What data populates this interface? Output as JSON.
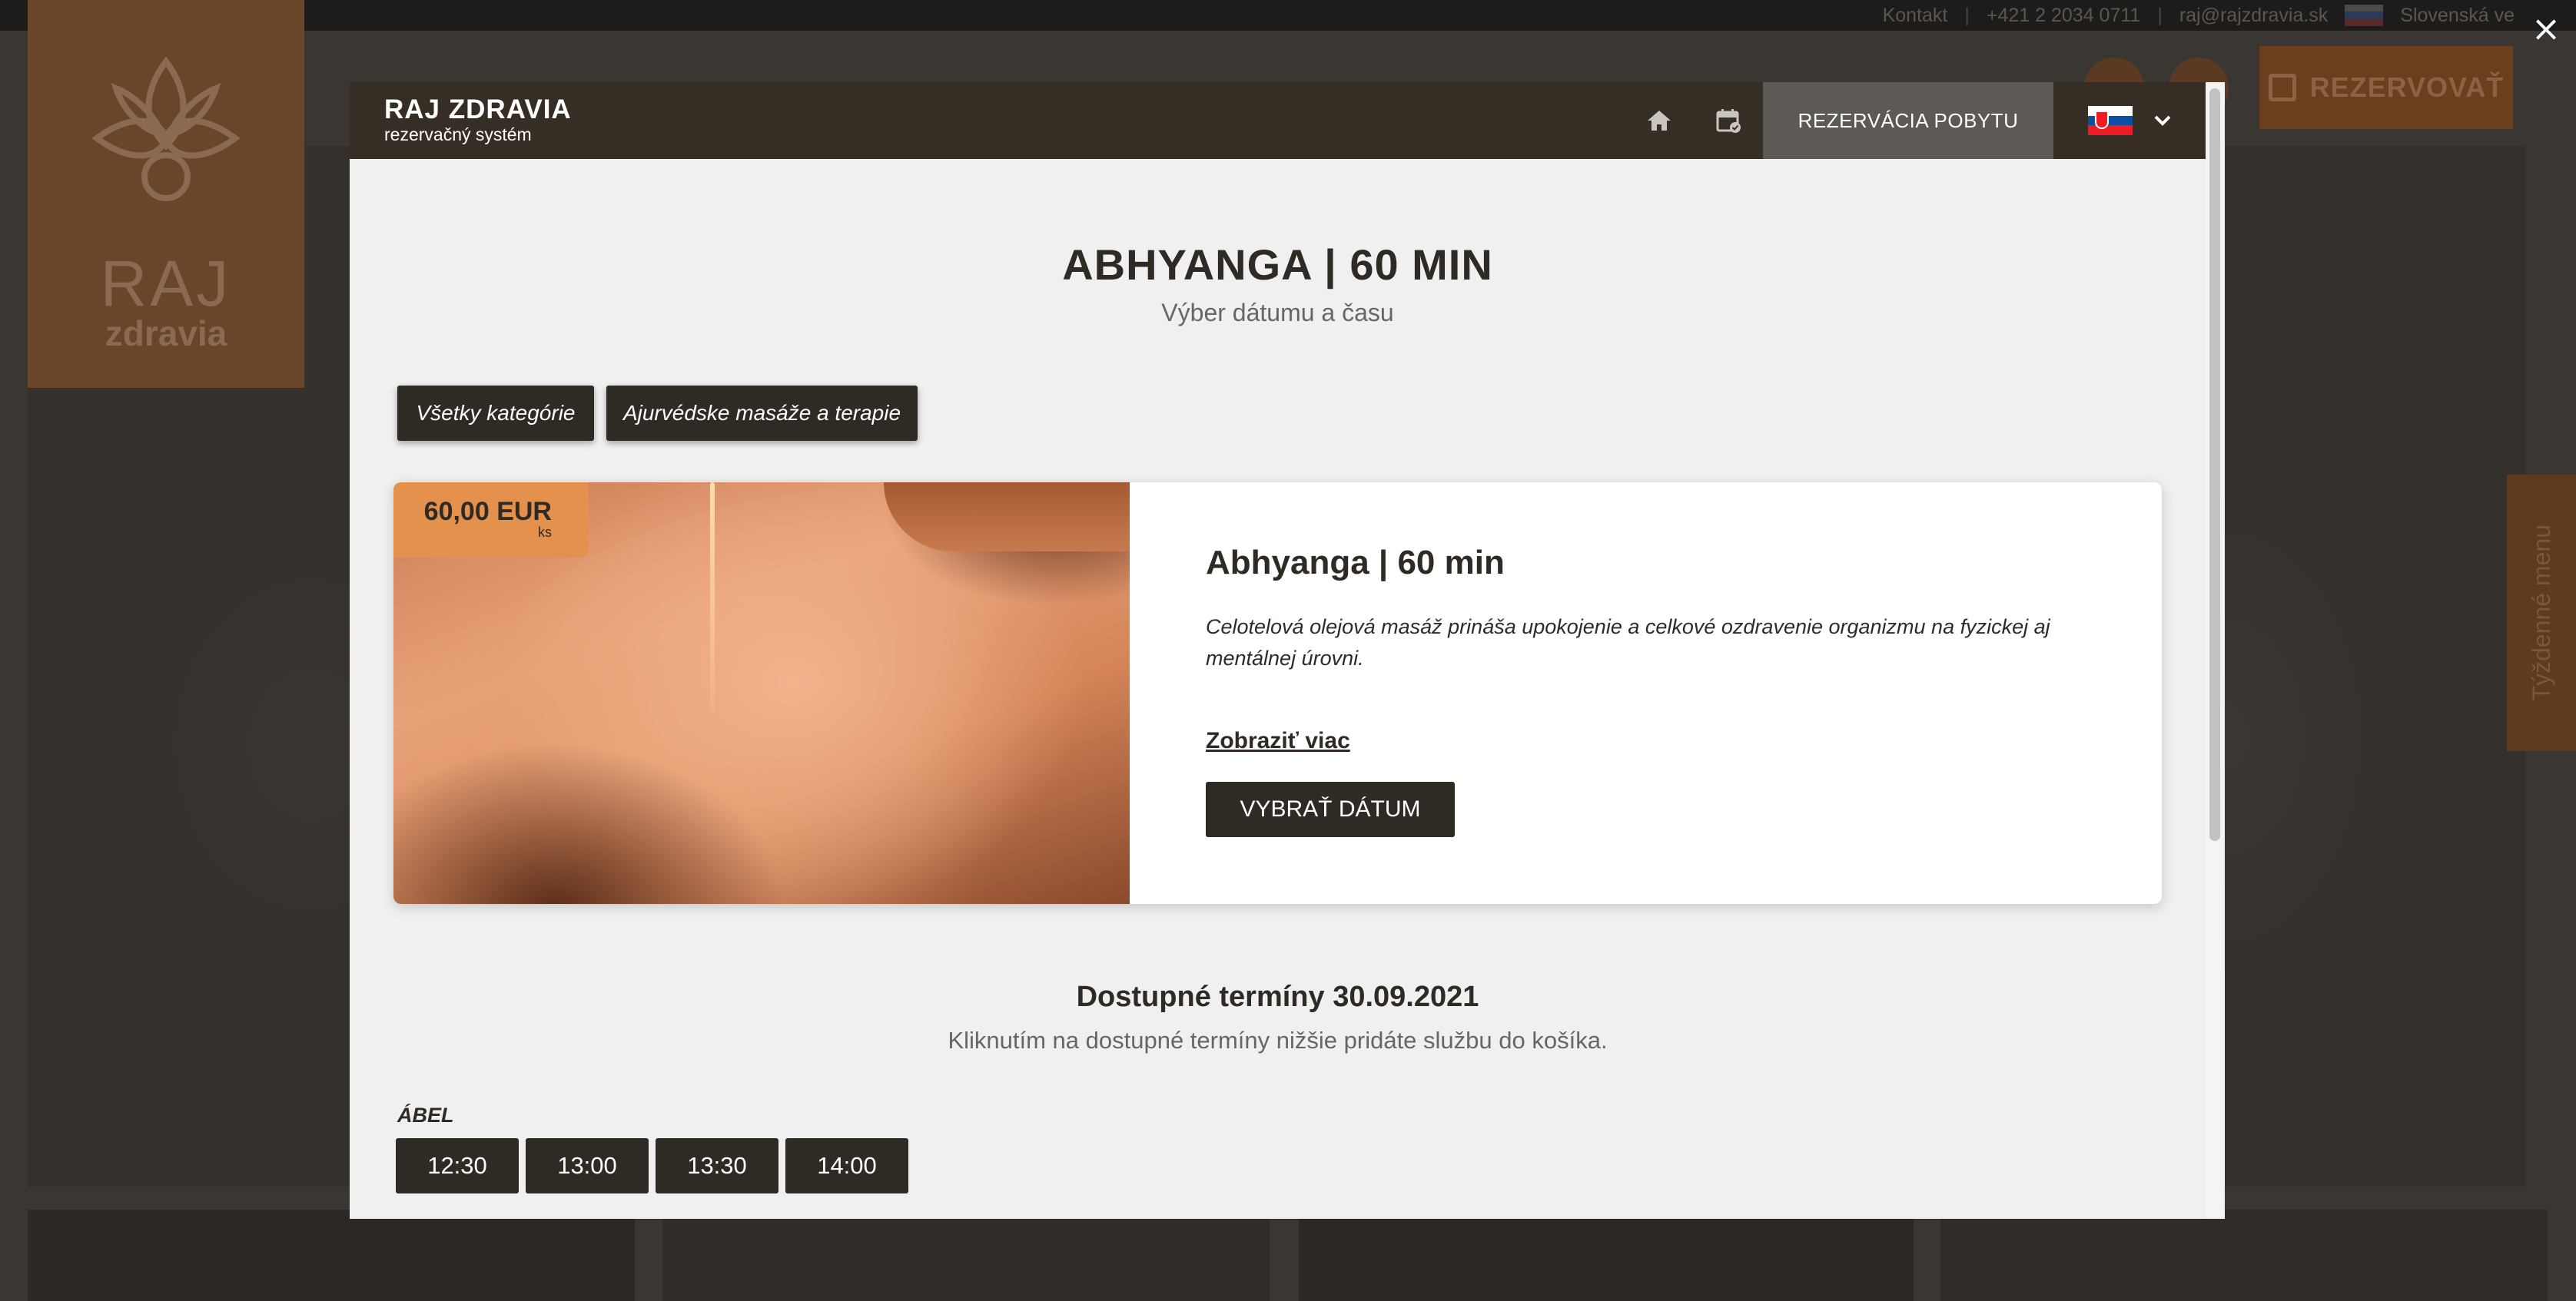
{
  "background": {
    "top_links": [
      "Kontakt",
      "+421 2 2034 0711",
      "raj@rajzdravia.sk",
      "Slovenská ve"
    ],
    "logo_line1": "RAJ",
    "logo_line2": "zdravia",
    "reserve_label": "REZERVOVAŤ",
    "side_tab": "Týždenné menu"
  },
  "close_label": "×",
  "header": {
    "brand_title": "RAJ ZDRAVIA",
    "brand_subtitle": "rezervačný systém",
    "home_icon": "home-icon",
    "calendar_icon": "calendar-check-icon",
    "reserve_stay": "REZERVÁCIA POBYTU",
    "language_flag": "slovak-flag-icon",
    "language_dropdown_icon": "chevron-down-icon"
  },
  "page": {
    "title": "ABHYANGA | 60 MIN",
    "subtitle": "Výber dátumu a času"
  },
  "categories": [
    {
      "label": "Všetky kategórie"
    },
    {
      "label": "Ajurvédske masáže a terapie"
    }
  ],
  "service": {
    "price": "60,00 EUR",
    "unit": "ks",
    "name": "Abhyanga | 60 min",
    "description": "Celotelová olejová masáž prináša upokojenie a celkové ozdravenie organizmu na fyzickej aj mentálnej úrovni.",
    "more_link": "Zobraziť viac",
    "choose_button": "VYBRAŤ DÁTUM"
  },
  "availability": {
    "title": "Dostupné termíny 30.09.2021",
    "subtitle": "Kliknutím na dostupné termíny nižšie pridáte službu do košíka.",
    "staff_name": "ÁBEL",
    "slots": [
      "12:30",
      "13:00",
      "13:30",
      "14:00"
    ]
  },
  "colors": {
    "header_bg": "#362e25",
    "accent_orange": "#e4914d",
    "button_dark": "#302a24",
    "modal_bg": "#f0f0f0"
  }
}
